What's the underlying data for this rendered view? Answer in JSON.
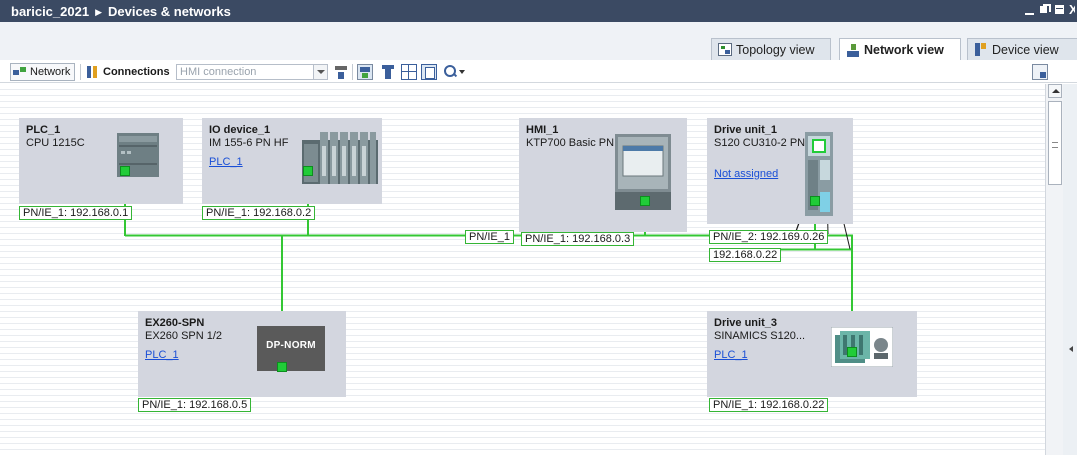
{
  "window": {
    "project": "baricic_2021",
    "separator": "▶",
    "section": "Devices & networks",
    "close_glyph": "X"
  },
  "view_tabs": [
    {
      "label": "Topology view",
      "icon": "topology-view-icon",
      "active": false
    },
    {
      "label": "Network view",
      "icon": "network-view-icon",
      "active": true
    },
    {
      "label": "Device view",
      "icon": "device-view-icon",
      "active": false
    }
  ],
  "toolbar": {
    "network_label": "Network",
    "connections_label": "Connections",
    "connection_type": "HMI connection"
  },
  "network": {
    "subnet_label": "PN/IE_1",
    "line_color": "#34c734"
  },
  "devices": [
    {
      "name": "PLC_1",
      "type": "CPU 1215C",
      "link": "",
      "ip": "PN/IE_1: 192.168.0.1"
    },
    {
      "name": "IO device_1",
      "type": "IM 155-6 PN HF",
      "link": "PLC_1",
      "ip": "PN/IE_1: 192.168.0.2"
    },
    {
      "name": "HMI_1",
      "type": "KTP700 Basic PN",
      "link": "",
      "ip": "PN/IE_1: 192.168.0.3"
    },
    {
      "name": "Drive unit_1",
      "type": "S120 CU310-2 PN",
      "link": "Not assigned",
      "ip": "PN/IE_2: 192.169.0.26",
      "ip2": "192.168.0.22"
    },
    {
      "name": "EX260-SPN",
      "type": "EX260 SPN 1/2",
      "link": "PLC_1",
      "ip": "PN/IE_1: 192.168.0.5",
      "module_label": "DP-NORM"
    },
    {
      "name": "Drive unit_3",
      "type": "SINAMICS S120...",
      "link": "PLC_1",
      "ip": "PN/IE_1: 192.168.0.22"
    }
  ]
}
